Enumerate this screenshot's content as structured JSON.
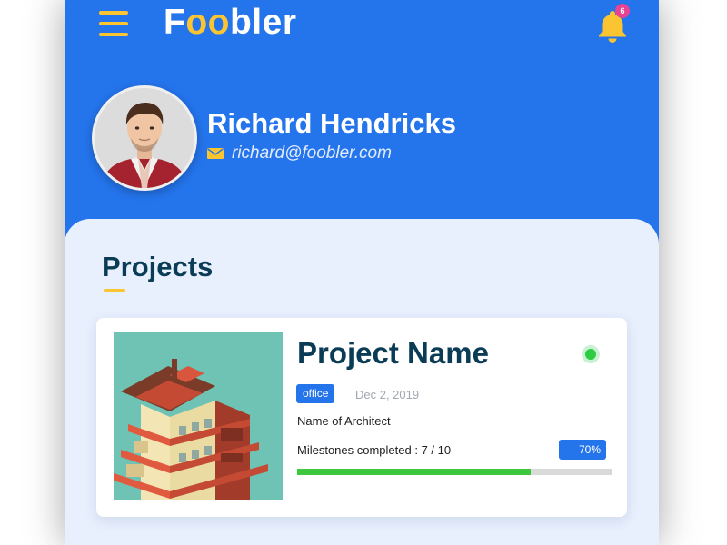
{
  "app": {
    "brand": {
      "part1": "F",
      "part2": "oo",
      "part3": "bler"
    },
    "notifications": {
      "count": "6"
    }
  },
  "user": {
    "name": "Richard Hendricks",
    "email": "richard@foobler.com"
  },
  "projects": {
    "title": "Projects",
    "items": [
      {
        "name": "Project Name",
        "tag": "office",
        "date": "Dec 2, 2019",
        "architect": "Name of Architect",
        "milestones_label": "Milestones completed : 7 / 10",
        "progress_label": "70%",
        "progress": 0.74,
        "status": "active"
      }
    ]
  },
  "colors": {
    "header_blue": "#2474ec",
    "accent_yellow": "#fbc531",
    "title_navy": "#0b3c55",
    "progress_green": "#3cc73c",
    "status_green": "#2ecc40",
    "badge_pink": "#e84393"
  },
  "icons": {
    "menu": "hamburger-menu-icon",
    "notifications": "bell-icon",
    "email": "envelope-icon",
    "status": "status-dot-icon"
  }
}
